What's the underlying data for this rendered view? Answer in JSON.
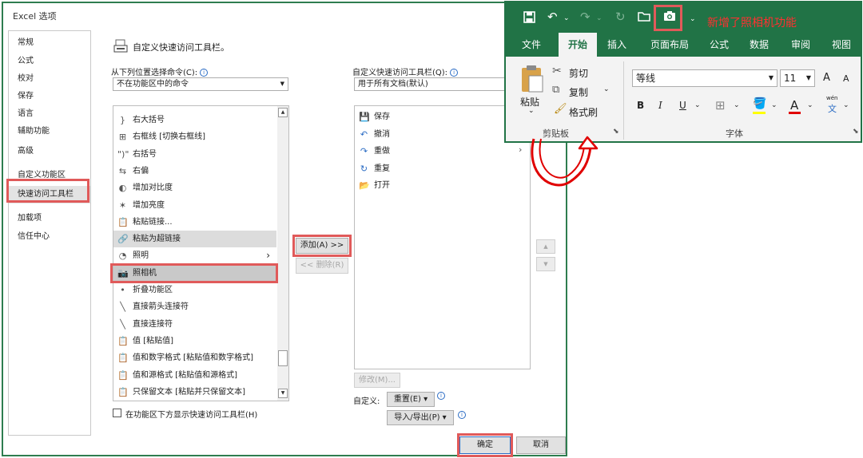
{
  "dialog": {
    "title": "Excel 选项",
    "close_glyph": "×",
    "nav": [
      {
        "label": "常规"
      },
      {
        "label": "公式"
      },
      {
        "label": "校对"
      },
      {
        "label": "保存"
      },
      {
        "label": "语言"
      },
      {
        "label": "辅助功能"
      },
      {
        "label": "高级"
      },
      {
        "label": "自定义功能区"
      },
      {
        "label": "快速访问工具栏"
      },
      {
        "label": "加载项"
      },
      {
        "label": "信任中心"
      }
    ],
    "section_title": "自定义快速访问工具栏。",
    "choose_from_label": "从下列位置选择命令(C):",
    "choose_from_value": "不在功能区中的命令",
    "customize_label": "自定义快速访问工具栏(Q):",
    "customize_value": "用于所有文档(默认)",
    "commands": [
      {
        "label": "右大括号",
        "icon": "}"
      },
      {
        "label": "右框线 [切换右框线]",
        "icon": "⊞"
      },
      {
        "label": "右括号",
        "icon": "\")\""
      },
      {
        "label": "右偏",
        "icon": "⇆"
      },
      {
        "label": "增加对比度",
        "icon": "◐"
      },
      {
        "label": "增加亮度",
        "icon": "✶"
      },
      {
        "label": "粘贴链接...",
        "icon": "📋"
      },
      {
        "label": "粘贴为超链接",
        "icon": "🔗"
      },
      {
        "label": "照明",
        "icon": "◔",
        "submenu": "›"
      },
      {
        "label": "照相机",
        "icon": "📷"
      },
      {
        "label": "折叠功能区",
        "icon": "•"
      },
      {
        "label": "直接箭头连接符",
        "icon": "╲"
      },
      {
        "label": "直接连接符",
        "icon": "╲"
      },
      {
        "label": "值 [粘贴值]",
        "icon": "📋"
      },
      {
        "label": "值和数字格式 [粘贴值和数字格式]",
        "icon": "📋"
      },
      {
        "label": "值和源格式 [粘贴值和源格式]",
        "icon": "📋"
      },
      {
        "label": "只保留文本 [粘贴并只保留文本]",
        "icon": "📋"
      }
    ],
    "qat_items": [
      {
        "label": "保存",
        "icon": "💾"
      },
      {
        "label": "撤消",
        "icon": "↶"
      },
      {
        "label": "重做",
        "icon": "↷"
      },
      {
        "label": "重复",
        "icon": "↻"
      },
      {
        "label": "打开",
        "icon": "📂"
      }
    ],
    "add_button": "添加(A) >>",
    "remove_button": "<< 删除(R)",
    "modify_button": "修改(M)...",
    "customize_row_label": "自定义:",
    "reset_button": "重置(E) ▾",
    "import_export_button": "导入/导出(P) ▾",
    "checkbox_label": "在功能区下方显示快速访问工具栏(H)",
    "ok_button": "确定",
    "cancel_button": "取消",
    "scroll_up": "▲",
    "scroll_down": "▼",
    "more_glyph": "›"
  },
  "ribbon": {
    "new_feature_text": "新增了照相机功能",
    "tabs": [
      "文件",
      "开始",
      "插入",
      "页面布局",
      "公式",
      "数据",
      "审阅",
      "视图"
    ],
    "clipboard": {
      "paste": "粘贴",
      "cut": "剪切",
      "copy": "复制",
      "format_painter": "格式刷",
      "group": "剪贴板"
    },
    "font": {
      "name": "等线",
      "size": "11",
      "group": "字体",
      "grow": "A",
      "shrink": "A",
      "bold": "B",
      "italic": "I",
      "underline": "U",
      "font_color_letter": "A",
      "wen_top": "wén",
      "wen_bottom": "文"
    },
    "colors": {
      "accent": "#217346",
      "highlight": "#e05a5a",
      "annotation": "#ff3030"
    }
  }
}
